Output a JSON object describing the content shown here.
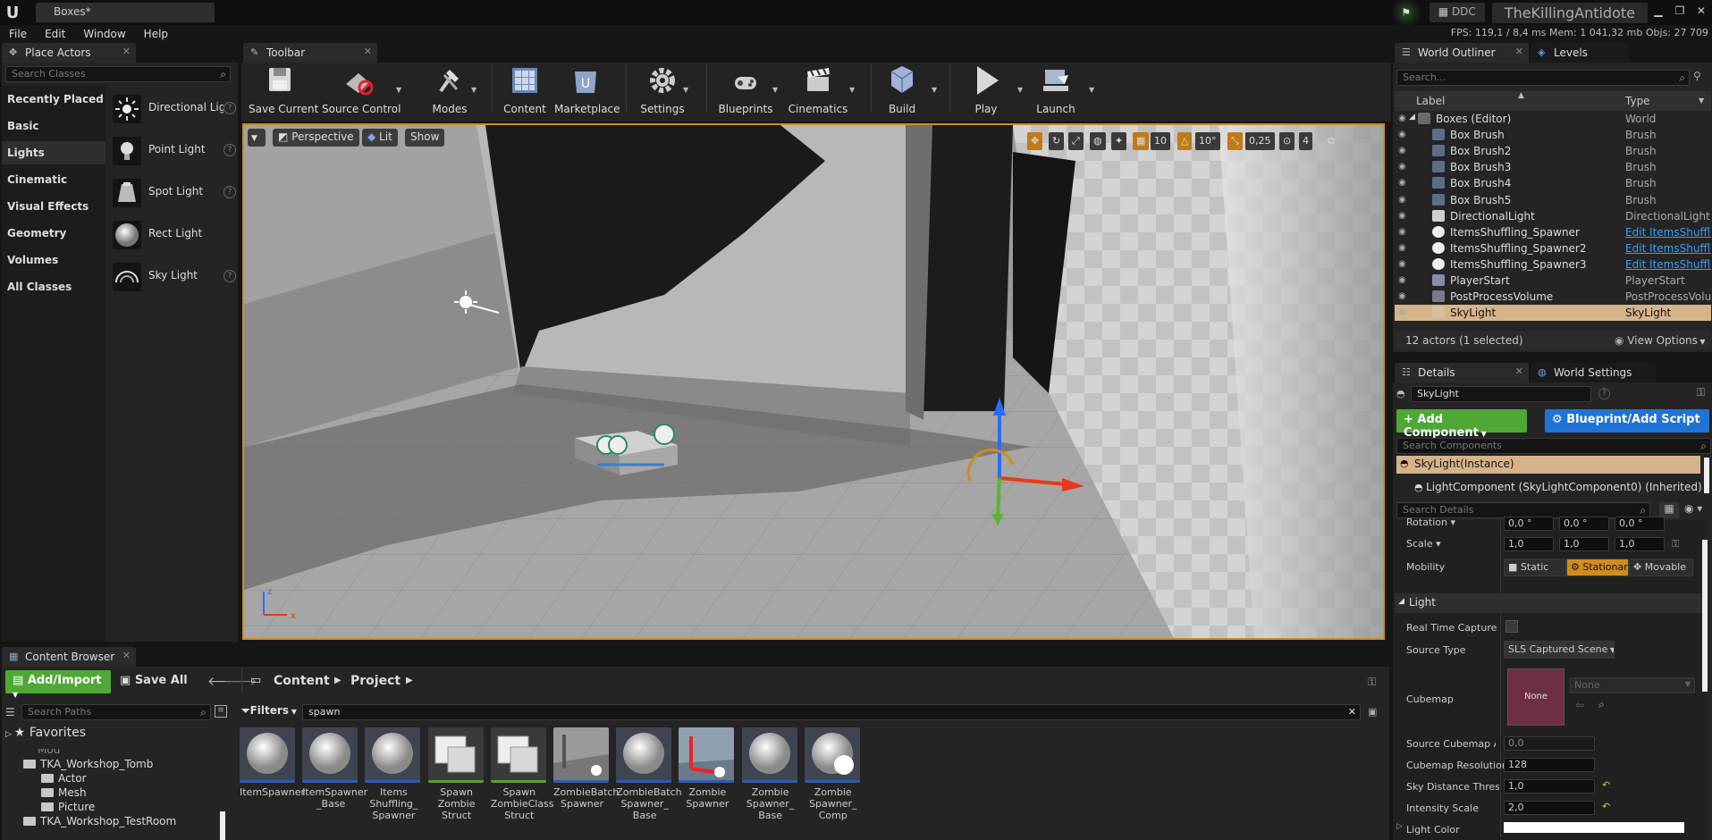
{
  "window": {
    "doc_tab": "Boxes*",
    "ddc": "DDC",
    "project": "TheKillingAntidote",
    "menu": [
      "File",
      "Edit",
      "Window",
      "Help"
    ],
    "stats": "FPS: 119,1  /  8,4 ms   Mem: 1 041,32 mb   Objs: 27 709"
  },
  "place_actors": {
    "tab": "Place Actors",
    "search_placeholder": "Search Classes",
    "categories": [
      "Recently Placed",
      "Basic",
      "Lights",
      "Cinematic",
      "Visual Effects",
      "Geometry",
      "Volumes",
      "All Classes"
    ],
    "selected_category": "Lights",
    "items": [
      "Directional Light",
      "Point Light",
      "Spot Light",
      "Rect Light",
      "Sky Light"
    ]
  },
  "toolbar": {
    "tab": "Toolbar",
    "buttons": [
      "Save Current",
      "Source Control",
      "Modes",
      "Content",
      "Marketplace",
      "Settings",
      "Blueprints",
      "Cinematics",
      "Build",
      "Play",
      "Launch"
    ]
  },
  "viewport": {
    "perspective": "Perspective",
    "lit": "Lit",
    "show": "Show",
    "grid_snap": "10",
    "rot_snap": "10°",
    "scale_snap": "0,25",
    "cam_speed": "4"
  },
  "outliner": {
    "tabs": [
      "World Outliner",
      "Levels"
    ],
    "search_placeholder": "Search...",
    "col_label": "Label",
    "col_type": "Type",
    "rows": [
      {
        "name": "Boxes (Editor)",
        "type": "World",
        "link": false
      },
      {
        "name": "Box Brush",
        "type": "Brush",
        "link": false
      },
      {
        "name": "Box Brush2",
        "type": "Brush",
        "link": false
      },
      {
        "name": "Box Brush3",
        "type": "Brush",
        "link": false
      },
      {
        "name": "Box Brush4",
        "type": "Brush",
        "link": false
      },
      {
        "name": "Box Brush5",
        "type": "Brush",
        "link": false
      },
      {
        "name": "DirectionalLight",
        "type": "DirectionalLight",
        "link": false
      },
      {
        "name": "ItemsShuffling_Spawner",
        "type": "Edit ItemsShuffling_Spawner",
        "link": true
      },
      {
        "name": "ItemsShuffling_Spawner2",
        "type": "Edit ItemsShuffling_Spawner",
        "link": true
      },
      {
        "name": "ItemsShuffling_Spawner3",
        "type": "Edit ItemsShuffling_Spawner",
        "link": true
      },
      {
        "name": "PlayerStart",
        "type": "PlayerStart",
        "link": false
      },
      {
        "name": "PostProcessVolume",
        "type": "PostProcessVolume",
        "link": false
      },
      {
        "name": "SkyLight",
        "type": "SkyLight",
        "link": false
      }
    ],
    "selected_row": "SkyLight",
    "summary": "12 actors (1 selected)",
    "view_options": "View Options"
  },
  "details": {
    "tabs": [
      "Details",
      "World Settings"
    ],
    "actor_name": "SkyLight",
    "add_component": "+ Add Component",
    "blueprint": "Blueprint/Add Script",
    "search_components": "Search Components",
    "instance": "SkyLight(Instance)",
    "component": "LightComponent (SkyLightComponent0) (Inherited)",
    "search_details": "Search Details",
    "rotation_label": "Rotation",
    "rotation": [
      "0,0 °",
      "0,0 °",
      "0,0 °"
    ],
    "scale_label": "Scale",
    "scale": [
      "1,0",
      "1,0",
      "1,0"
    ],
    "mobility_label": "Mobility",
    "mobility": [
      "Static",
      "Stationary",
      "Movable"
    ],
    "section_light": "Light",
    "real_time_capture": "Real Time Capture",
    "source_type_label": "Source Type",
    "source_type": "SLS Captured Scene",
    "cubemap_label": "Cubemap",
    "cubemap_none": "None",
    "cubemap_select": "None",
    "source_cubemap_angle_label": "Source Cubemap Angle",
    "source_cubemap_angle": "0,0",
    "cubemap_resolution_label": "Cubemap Resolution",
    "cubemap_resolution": "128",
    "sky_distance_label": "Sky Distance Threshold",
    "sky_distance": "1,0",
    "intensity_label": "Intensity Scale",
    "intensity": "2,0",
    "light_color_label": "Light Color"
  },
  "content_browser": {
    "tab": "Content Browser",
    "add_import": "Add/Import",
    "save_all": "Save All",
    "path": [
      "Content",
      "Project"
    ],
    "search_paths": "Search Paths",
    "filters": "Filters",
    "search_text": "spawn",
    "favorites": "Favorites",
    "tree": [
      "Mod",
      "TKA_Workshop_Tomb",
      "Actor",
      "Mesh",
      "Picture",
      "TKA_Workshop_TestRoom"
    ],
    "assets": [
      {
        "l1": "ItemSpawner",
        "l2": "",
        "l3": ""
      },
      {
        "l1": "ItemSpawner",
        "l2": "_Base",
        "l3": ""
      },
      {
        "l1": "Items",
        "l2": "Shuffling_",
        "l3": "Spawner"
      },
      {
        "l1": "Spawn",
        "l2": "Zombie",
        "l3": "Struct"
      },
      {
        "l1": "Spawn",
        "l2": "ZombieClass",
        "l3": "Struct"
      },
      {
        "l1": "ZombieBatch",
        "l2": "Spawner",
        "l3": ""
      },
      {
        "l1": "ZombieBatch",
        "l2": "Spawner_",
        "l3": "Base"
      },
      {
        "l1": "Zombie",
        "l2": "Spawner",
        "l3": ""
      },
      {
        "l1": "Zombie",
        "l2": "Spawner_",
        "l3": "Base"
      },
      {
        "l1": "Zombie",
        "l2": "Spawner_",
        "l3": "Comp"
      }
    ]
  },
  "colors": {
    "accent": "#d18c1f",
    "select": "#d6b48a",
    "green": "#4fa836",
    "blue": "#1f73d6",
    "link": "#3d9bf5"
  }
}
